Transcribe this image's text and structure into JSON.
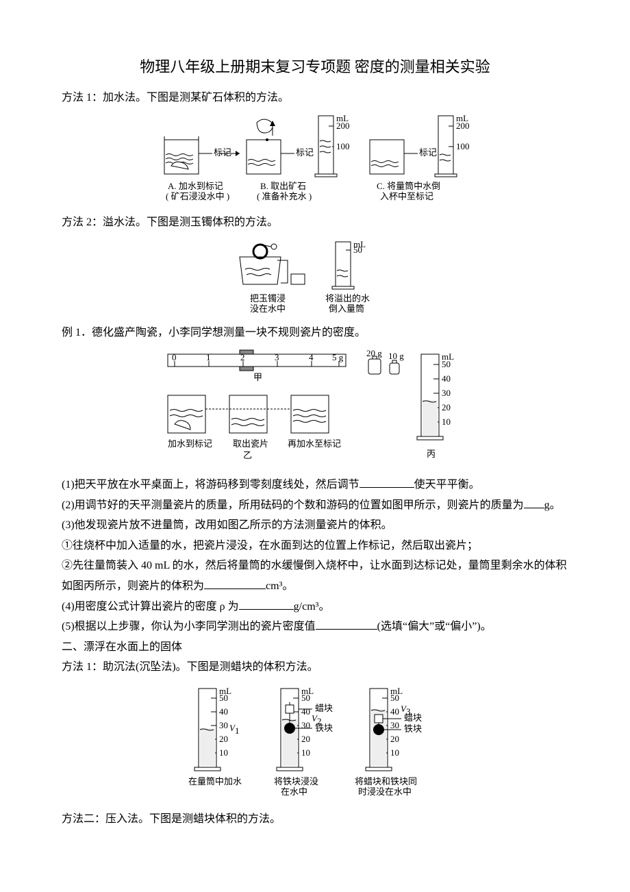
{
  "title": "物理八年级上册期末复习专项题 密度的测量相关实验",
  "method1_title": "方法 1：加水法。下图是测某矿石体积的方法。",
  "fig1": {
    "a_cap1": "A. 加水到标记",
    "a_cap2": "( 矿石浸没水中 )",
    "b_cap1": "B. 取出矿石",
    "b_cap2": "( 准备补充水 )",
    "c_cap1": "C. 将量筒中水倒",
    "c_cap2": "入杯中至标记",
    "mark": "标记",
    "ml": "mL",
    "t200": "200",
    "t100": "100"
  },
  "method2_title": "方法 2：溢水法。下图是测玉镯体积的方法。",
  "fig2": {
    "cap1a": "把玉镯浸",
    "cap1b": "没在水中",
    "cap2a": "将溢出的水",
    "cap2b": "倒入量筒",
    "ml": "mL",
    "t50": "50"
  },
  "ex1_title": "例 1．德化盛产陶瓷，小李同学想测量一块不规则瓷片的密度。",
  "fig3": {
    "scale": [
      "0",
      "1",
      "2",
      "3",
      "4",
      "5 g"
    ],
    "scale_label": "甲",
    "cap1": "加水到标记",
    "cap2": "取出瓷片",
    "cap3": "再加水至标记",
    "yi": "乙",
    "w20": "20 g",
    "w10": "10 g",
    "ml": "mL",
    "t50": "50",
    "t40": "40",
    "t30": "30",
    "t20": "20",
    "t10": "10",
    "bing": "丙"
  },
  "q1": "(1)把天平放在水平桌面上，将游码移到零刻度线处，然后调节",
  "q1_tail": "使天平平衡。",
  "q2": "(2)用调节好的天平测量瓷片的质量，所用砝码的个数和游码的位置如图甲所示，则瓷片的质量为",
  "q2_tail": "g。",
  "q3": "(3)他发现瓷片放不进量筒，改用如图乙所示的方法测量瓷片的体积。",
  "q3_1": "①往烧杯中加入适量的水，把瓷片浸没，在水面到达的位置上作标记，然后取出瓷片；",
  "q3_2a": "②先往量筒装入 40 mL 的水，然后将量筒的水缓慢倒入烧杯中，让水面到达标记处，量筒里剩余水的体积",
  "q3_2b": "如图丙所示，则瓷片的体积为",
  "q3_2_tail": "cm³。",
  "q4": "(4)用密度公式计算出瓷片的密度 ρ 为",
  "q4_tail": "g/cm³。",
  "q5": "(5)根据以上步骤，你认为小李同学测出的瓷片密度值",
  "q5_tail": "(选填“偏大”或“偏小”)。",
  "sec2_title": "二、漂浮在水面上的固体",
  "method2_1": "方法 1：助沉法(沉坠法)。下图是测蜡块的体积方法。",
  "fig4": {
    "ml": "mL",
    "t50": "50",
    "t40": "40",
    "t30": "30",
    "t20": "20",
    "t10": "10",
    "v1": "V",
    "v1s": "1",
    "v2": "V",
    "v2s": "2",
    "v3": "V",
    "v3s": "3",
    "wax": "蜡块",
    "iron": "铁块",
    "cap1": "在量筒中加水",
    "cap2a": "将铁块浸没",
    "cap2b": "在水中",
    "cap3a": "将蜡块和铁块同",
    "cap3b": "时浸没在水中"
  },
  "method2_2": "方法二：压入法。下图是测蜡块体积的方法。"
}
